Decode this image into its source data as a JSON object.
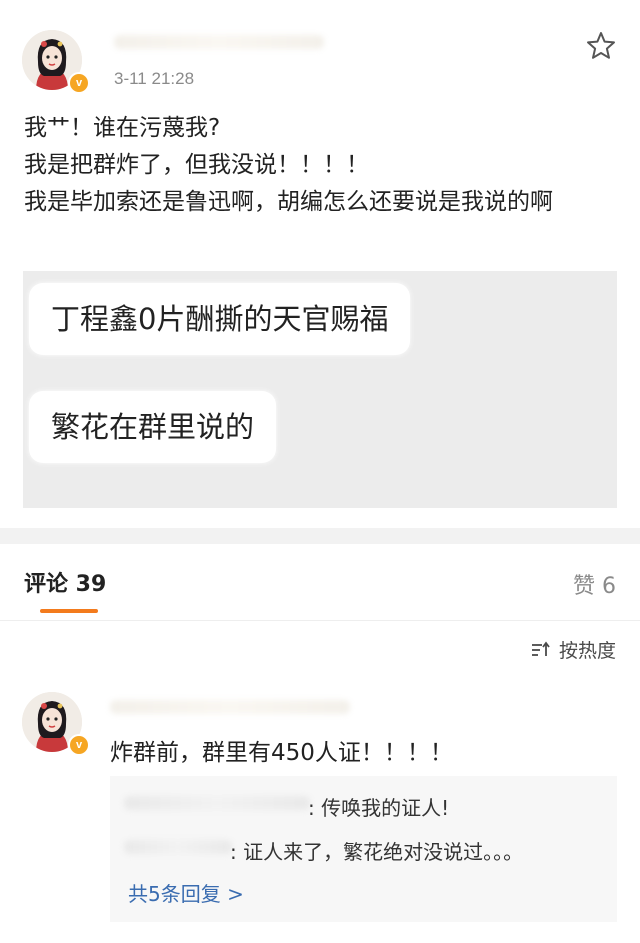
{
  "post": {
    "timestamp": "3-11 21:28",
    "lines": [
      "我艹！谁在污蔑我?",
      "我是把群炸了，但我没说！！！！",
      "我是毕加索还是鲁迅啊，胡编怎么还要说是我说的啊"
    ],
    "image_bubbles": [
      "丁程鑫0片酬撕的天官赐福",
      "繁花在群里说的"
    ]
  },
  "tabs": {
    "comments_label": "评论 39",
    "likes_label": "赞 6"
  },
  "sort": {
    "label": "按热度",
    "icon": "sort-icon"
  },
  "comment": {
    "text": "炸群前，群里有450人证！！！！",
    "replies": [
      ": 传唤我的证人!",
      ": 证人来了，繁花绝对没说过。。。"
    ],
    "more_replies": "共5条回复 >"
  },
  "colors": {
    "accent": "#f37b1d",
    "link": "#3a6cb0",
    "verified_badge": "#f6a623",
    "muted_text": "#8a8a8a"
  }
}
